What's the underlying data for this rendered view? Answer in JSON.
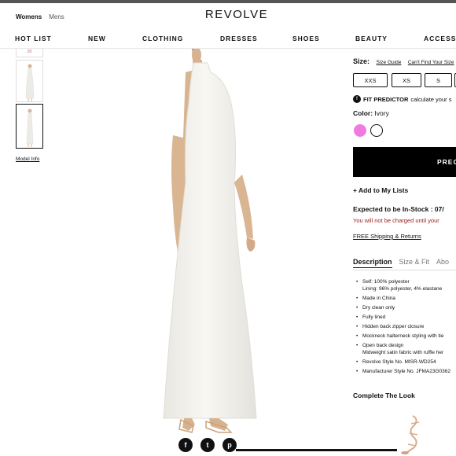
{
  "header": {
    "genders": [
      "Womens",
      "Mens"
    ],
    "logo": "REVOLVE"
  },
  "nav": {
    "items": [
      "HOT LIST",
      "NEW",
      "CLOTHING",
      "DRESSES",
      "SHOES",
      "BEAUTY",
      "ACCESSO"
    ]
  },
  "gallery": {
    "thumb_caption": "20",
    "model_info": "Model Info"
  },
  "social": {
    "facebook": "f",
    "twitter": "t",
    "pinterest": "p"
  },
  "product": {
    "size_label": "Size:",
    "size_guide": "Size Guide",
    "cant_find": "Can't Find Your Size",
    "sizes": [
      "XXS",
      "XS",
      "S",
      ""
    ],
    "fit_predictor_icon": "f",
    "fit_predictor_label": "FIT PREDICTOR",
    "fit_predictor_text": "calculate your s",
    "color_label": "Color:",
    "color_value": "Ivory",
    "swatches": [
      {
        "name": "pink",
        "hex": "#f07be0"
      },
      {
        "name": "ivory",
        "hex": "#ffffff"
      }
    ],
    "predict_button": "PREC",
    "add_to_lists": "+ Add to My Lists",
    "expected_stock": "Expected to be In-Stock : 07/",
    "not_charged": "You will not be charged until your",
    "free_shipping": "FREE Shipping & Returns",
    "tabs": [
      "Description",
      "Size & Fit",
      "Abo"
    ],
    "details": [
      [
        "Self: 100% polyester",
        "Lining: 96% polyester, 4% elastane"
      ],
      [
        "Made in China"
      ],
      [
        "Dry clean only"
      ],
      [
        "Fully lined"
      ],
      [
        "Hidden back zipper closure"
      ],
      [
        "Mockneck halterneck styling with tie"
      ],
      [
        "Open back design",
        "Midweight satin fabric with ruffle her"
      ],
      [
        "Revolve Style No. MISR-WD254"
      ],
      [
        "Manufacturer Style No. JFMA23G0362"
      ]
    ],
    "complete_the_look": "Complete The Look"
  },
  "colors": {
    "accent": "#111111",
    "warning_red": "#9b1c1c",
    "dress": "#f4f3ef"
  }
}
